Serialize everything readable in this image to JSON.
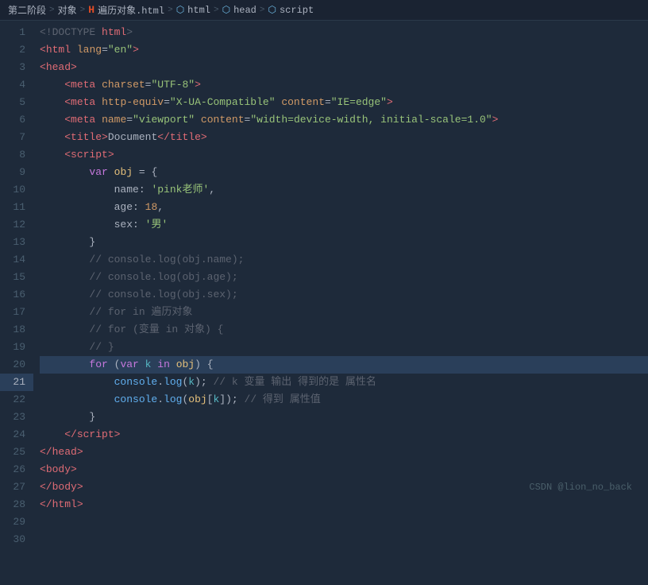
{
  "breadcrumb": {
    "items": [
      {
        "label": "第二阶段",
        "icon": "none"
      },
      {
        "label": "对象",
        "icon": "none"
      },
      {
        "label": "遍历对象.html",
        "icon": "html"
      },
      {
        "label": "html",
        "icon": "folder"
      },
      {
        "label": "head",
        "icon": "folder"
      },
      {
        "label": "script",
        "icon": "folder"
      }
    ]
  },
  "watermark": "CSDN @lion_no_back",
  "lines": [
    {
      "num": 1
    },
    {
      "num": 2
    },
    {
      "num": 3
    },
    {
      "num": 4
    },
    {
      "num": 5
    },
    {
      "num": 6
    },
    {
      "num": 7
    },
    {
      "num": 8
    },
    {
      "num": 9
    },
    {
      "num": 10
    },
    {
      "num": 11
    },
    {
      "num": 12
    },
    {
      "num": 13
    },
    {
      "num": 14
    },
    {
      "num": 15
    },
    {
      "num": 16
    },
    {
      "num": 17
    },
    {
      "num": 18
    },
    {
      "num": 19
    },
    {
      "num": 20
    },
    {
      "num": 21
    },
    {
      "num": 22
    },
    {
      "num": 23
    },
    {
      "num": 24
    },
    {
      "num": 25
    },
    {
      "num": 26
    },
    {
      "num": 27
    },
    {
      "num": 28
    },
    {
      "num": 29
    },
    {
      "num": 30
    }
  ]
}
